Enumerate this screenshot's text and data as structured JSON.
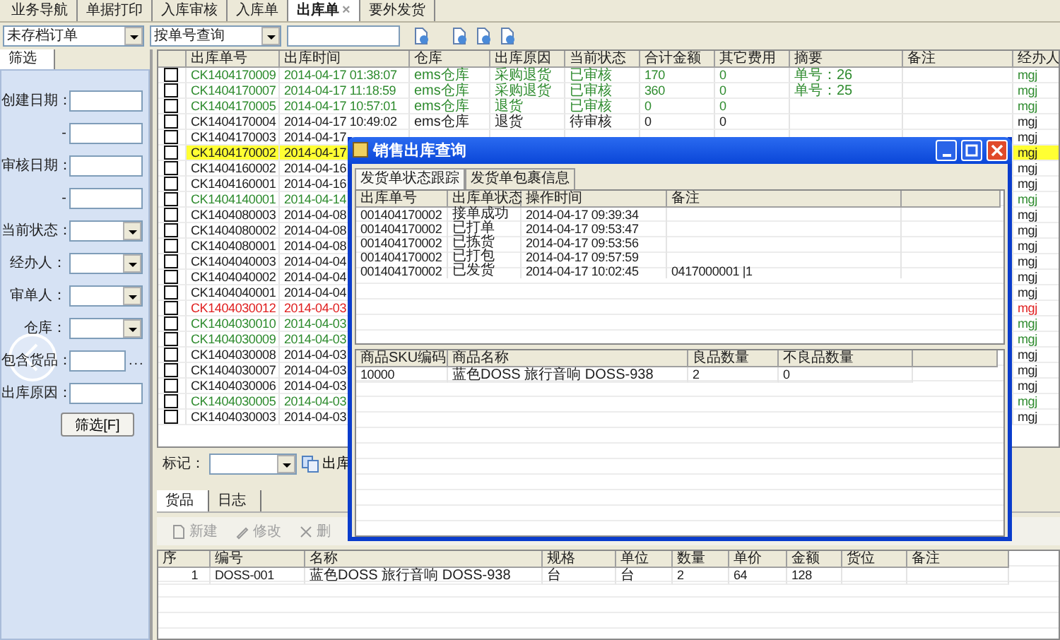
{
  "nav_tabs": [
    {
      "label": "业务导航",
      "selected": false
    },
    {
      "label": "单据打印",
      "selected": false
    },
    {
      "label": "入库审核",
      "selected": false
    },
    {
      "label": "入库单",
      "selected": false
    },
    {
      "label": "出库单",
      "selected": true,
      "close": "×"
    },
    {
      "label": "要外发货",
      "selected": false
    }
  ],
  "toolbar": {
    "filter_select": "未存档订单",
    "query_select": "按单号查询"
  },
  "filter_panel": {
    "tab": "筛选",
    "fields": [
      {
        "kind": "text",
        "label": "创建日期："
      },
      {
        "kind": "text",
        "label": "-"
      },
      {
        "kind": "text",
        "label": "审核日期："
      },
      {
        "kind": "text",
        "label": "-"
      },
      {
        "kind": "select",
        "label": "当前状态："
      },
      {
        "kind": "select",
        "label": "经办人："
      },
      {
        "kind": "select",
        "label": "审单人："
      },
      {
        "kind": "select",
        "label": "仓库："
      },
      {
        "kind": "picker",
        "label": "包含货品：",
        "more": "..."
      },
      {
        "kind": "text",
        "label": "出库原因："
      }
    ],
    "button": "筛选[F]"
  },
  "orders": {
    "columns": [
      "出库单号",
      "出库时间",
      "仓库",
      "出库原因",
      "当前状态",
      "合计金额",
      "其它费用",
      "摘要",
      "备注",
      "经办人"
    ],
    "rows": [
      {
        "id": "CK1404170009",
        "time": "2014-04-17  01:38:07",
        "warehouse": "ems仓库",
        "reason": "采购退货",
        "status": "已审核",
        "total": "170",
        "fees": "0",
        "summary": "单号：26",
        "handler": "mgj",
        "color": "#2e8b2e",
        "selected": false,
        "checked": false
      },
      {
        "id": "CK1404170007",
        "time": "2014-04-17  11:18:59",
        "warehouse": "ems仓库",
        "reason": "采购退货",
        "status": "已审核",
        "total": "360",
        "fees": "0",
        "summary": "单号：25",
        "handler": "mgj",
        "color": "#2e8b2e",
        "selected": false,
        "checked": false
      },
      {
        "id": "CK1404170005",
        "time": "2014-04-17  10:57:01",
        "warehouse": "ems仓库",
        "reason": "退货",
        "status": "已审核",
        "total": "0",
        "fees": "0",
        "handler": "mgj",
        "color": "#2e8b2e",
        "selected": false,
        "checked": false
      },
      {
        "id": "CK1404170004",
        "time": "2014-04-17  10:49:02",
        "warehouse": "ems仓库",
        "reason": "退货",
        "status": "待审核",
        "total": "0",
        "fees": "0",
        "handler": "mgj",
        "selected": false,
        "checked": false
      },
      {
        "id": "CK1404170003",
        "time": "2014-04-17",
        "handler": "mgj",
        "selected": false,
        "checked": false
      },
      {
        "id": "CK1404170002",
        "time": "2014-04-17",
        "handler": "mgj",
        "selected": true,
        "checked": false
      },
      {
        "id": "CK1404160002",
        "time": "2014-04-16",
        "handler": "mgj",
        "selected": false,
        "checked": false
      },
      {
        "id": "CK1404160001",
        "time": "2014-04-16",
        "handler": "mgj",
        "selected": false,
        "checked": false
      },
      {
        "id": "CK1404140001",
        "time": "2014-04-14",
        "handler": "mgj",
        "color": "#2e8b2e",
        "selected": false,
        "checked": false
      },
      {
        "id": "CK1404080003",
        "time": "2014-04-08",
        "handler": "mgj",
        "selected": false,
        "checked": false
      },
      {
        "id": "CK1404080002",
        "time": "2014-04-08",
        "handler": "mgj",
        "selected": false,
        "checked": false
      },
      {
        "id": "CK1404080001",
        "time": "2014-04-08",
        "handler": "mgj",
        "selected": false,
        "checked": false
      },
      {
        "id": "CK1404040003",
        "time": "2014-04-04",
        "handler": "mgj",
        "selected": false,
        "checked": false
      },
      {
        "id": "CK1404040002",
        "time": "2014-04-04",
        "handler": "mgj",
        "selected": false,
        "checked": false
      },
      {
        "id": "CK1404040001",
        "time": "2014-04-04",
        "handler": "mgj",
        "selected": false,
        "checked": false
      },
      {
        "id": "CK1404030012",
        "time": "2014-04-03",
        "handler": "mgj",
        "color": "#e02020",
        "selected": false,
        "checked": false
      },
      {
        "id": "CK1404030010",
        "time": "2014-04-03",
        "handler": "mgj",
        "color": "#2e8b2e",
        "selected": false,
        "checked": false
      },
      {
        "id": "CK1404030009",
        "time": "2014-04-03",
        "handler": "mgj",
        "color": "#2e8b2e",
        "selected": false,
        "checked": false
      },
      {
        "id": "CK1404030008",
        "time": "2014-04-03",
        "handler": "mgj",
        "selected": false,
        "checked": false
      },
      {
        "id": "CK1404030007",
        "time": "2014-04-03",
        "handler": "mgj",
        "selected": false,
        "checked": false
      },
      {
        "id": "CK1404030006",
        "time": "2014-04-03",
        "handler": "mgj",
        "selected": false,
        "checked": false
      },
      {
        "id": "CK1404030005",
        "time": "2014-04-03",
        "handler": "mgj",
        "color": "#2e8b2e",
        "selected": false,
        "checked": false
      },
      {
        "id": "CK1404030003",
        "time": "2014-04-03",
        "handler": "mgj",
        "selected": false,
        "checked": false
      }
    ]
  },
  "mark_bar": {
    "label": "标记：",
    "button": "出库"
  },
  "detail_tabs": [
    {
      "label": "货品",
      "selected": true
    },
    {
      "label": "日志",
      "selected": false
    }
  ],
  "goods_toolbar": [
    {
      "label": "新建",
      "disabled": true
    },
    {
      "label": "修改",
      "disabled": true
    },
    {
      "label": "删",
      "disabled": true
    }
  ],
  "goods": {
    "columns": [
      "序",
      "编号",
      "名称",
      "规格",
      "单位",
      "数量",
      "单价",
      "金额",
      "货位",
      "备注"
    ],
    "rows": [
      [
        "1",
        "DOSS-001",
        "蓝色DOSS 旅行音响 DOSS-938",
        "台",
        "台",
        "2",
        "64",
        "128",
        "",
        ""
      ]
    ]
  },
  "dialog": {
    "title": "销售出库查询",
    "tabs": [
      {
        "label": "发货单状态跟踪",
        "selected": true
      },
      {
        "label": "发货单包裹信息",
        "selected": false
      }
    ],
    "tracking": {
      "columns": [
        "出库单号",
        "出库单状态",
        "操作时间",
        "备注"
      ],
      "rows": [
        [
          "001404170002",
          "接单成功",
          "2014-04-17 09:39:34",
          ""
        ],
        [
          "001404170002",
          "已打单",
          "2014-04-17 09:53:47",
          ""
        ],
        [
          "001404170002",
          "已拣货",
          "2014-04-17 09:53:56",
          ""
        ],
        [
          "001404170002",
          "已打包",
          "2014-04-17 09:57:59",
          ""
        ],
        [
          "001404170002",
          "已发货",
          "2014-04-17 10:02:45",
          "0417000001 |1"
        ]
      ]
    },
    "items": {
      "columns": [
        "商品SKU编码",
        "商品名称",
        "良品数量",
        "不良品数量"
      ],
      "rows": [
        [
          "10000",
          "蓝色DOSS 旅行音响 DOSS-938",
          "2",
          "0"
        ]
      ]
    }
  }
}
